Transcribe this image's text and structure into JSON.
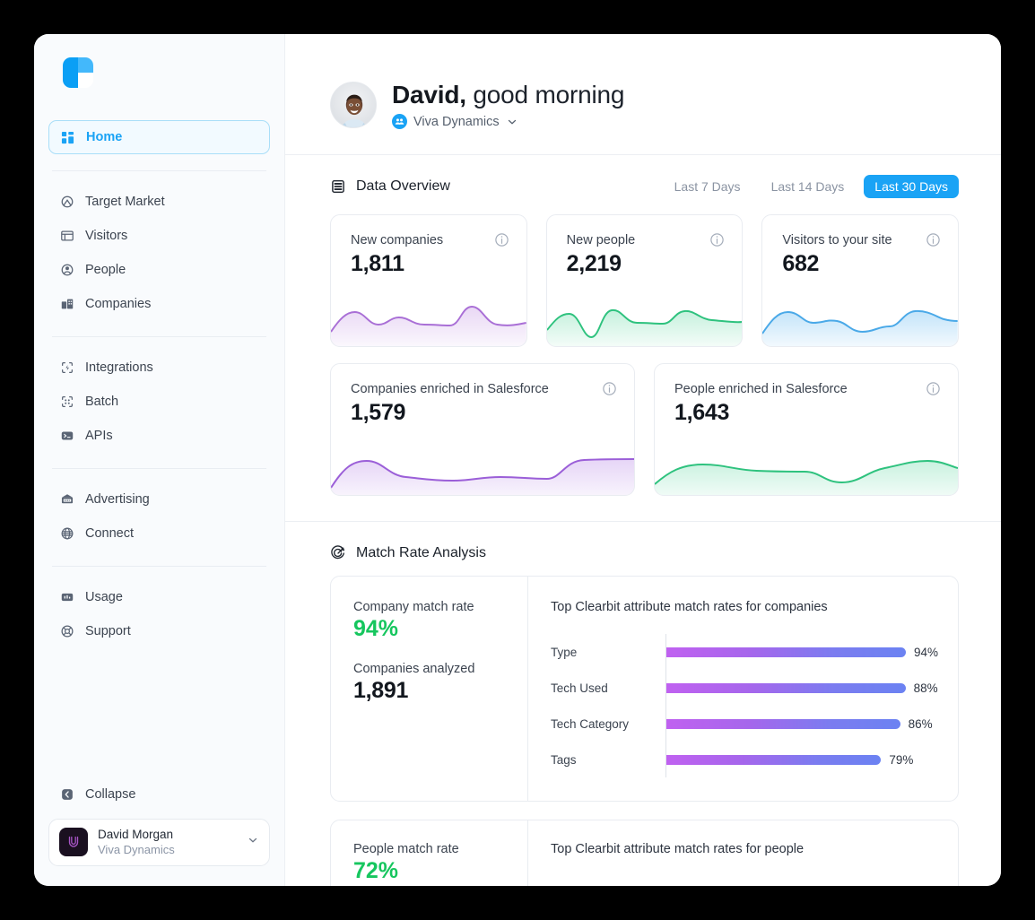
{
  "sidebar": {
    "logo_name": "clearbit-logo",
    "groups": [
      {
        "items": [
          {
            "label": "Home",
            "icon": "grid-icon",
            "active": true
          }
        ]
      },
      {
        "items": [
          {
            "label": "Target Market",
            "icon": "target-market-icon"
          },
          {
            "label": "Visitors",
            "icon": "visitors-icon"
          },
          {
            "label": "People",
            "icon": "people-icon"
          },
          {
            "label": "Companies",
            "icon": "companies-icon"
          }
        ]
      },
      {
        "items": [
          {
            "label": "Integrations",
            "icon": "integrations-icon"
          },
          {
            "label": "Batch",
            "icon": "batch-icon"
          },
          {
            "label": "APIs",
            "icon": "apis-icon"
          }
        ]
      },
      {
        "items": [
          {
            "label": "Advertising",
            "icon": "advertising-icon"
          },
          {
            "label": "Connect",
            "icon": "connect-globe-icon"
          }
        ]
      },
      {
        "items": [
          {
            "label": "Usage",
            "icon": "usage-icon"
          },
          {
            "label": "Support",
            "icon": "support-lifebuoy-icon"
          }
        ]
      }
    ],
    "collapse_label": "Collapse",
    "profile": {
      "name": "David Morgan",
      "org": "Viva Dynamics"
    }
  },
  "header": {
    "greeting_name": "David,",
    "greeting_rest": " good morning",
    "org": "Viva Dynamics"
  },
  "data_overview": {
    "title": "Data Overview",
    "ranges": [
      {
        "label": "Last 7 Days",
        "active": false
      },
      {
        "label": "Last 14 Days",
        "active": false
      },
      {
        "label": "Last 30 Days",
        "active": true
      }
    ],
    "cards_row_1": [
      {
        "label": "New companies",
        "value": "1,811",
        "color": "#b57bdc",
        "fill": "#b57bdc"
      },
      {
        "label": "New people",
        "value": "2,219",
        "color": "#3fcf8e",
        "fill": "#3fcf8e"
      },
      {
        "label": "Visitors to your site",
        "value": "682",
        "color": "#5ab4f0",
        "fill": "#5ab4f0"
      }
    ],
    "cards_row_2": [
      {
        "label": "Companies enriched in Salesforce",
        "value": "1,579",
        "color": "#a569e0",
        "fill": "#a569e0"
      },
      {
        "label": "People enriched in Salesforce",
        "value": "1,643",
        "color": "#3fcf8e",
        "fill": "#3fcf8e"
      }
    ]
  },
  "match_rate": {
    "title": "Match Rate Analysis",
    "company": {
      "rate_label": "Company match rate",
      "rate_value": "94%",
      "analyzed_label": "Companies analyzed",
      "analyzed_value": "1,891",
      "chart_title": "Top Clearbit attribute match rates for companies"
    },
    "people": {
      "rate_label": "People match rate",
      "rate_value": "72%",
      "chart_title": "Top Clearbit attribute match rates for people"
    }
  },
  "chart_data": {
    "type": "bar",
    "orientation": "horizontal",
    "title": "Top Clearbit attribute match rates for companies",
    "categories": [
      "Type",
      "Tech Used",
      "Tech Category",
      "Tags"
    ],
    "values": [
      94,
      88,
      86,
      79
    ],
    "value_labels": [
      "94%",
      "88%",
      "86%",
      "79%"
    ],
    "xlabel": "",
    "ylabel": "",
    "xlim": [
      0,
      100
    ],
    "grid": false,
    "legend": "none",
    "bar_gradient": [
      "#c061f0",
      "#6b82f2"
    ]
  }
}
